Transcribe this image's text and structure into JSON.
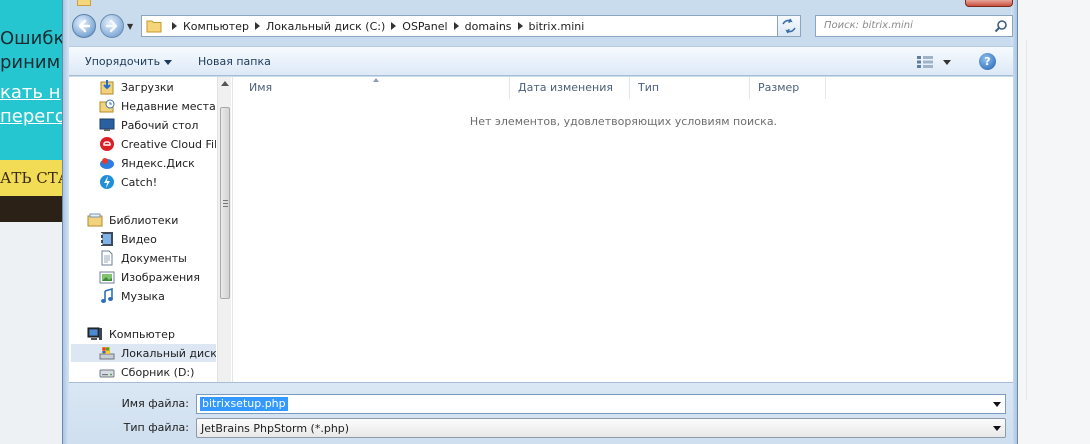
{
  "background": {
    "left_texts": [
      "Ошибк",
      "риним",
      "кать н",
      "перего"
    ],
    "yellow_text": "АТЬ СТА"
  },
  "address": {
    "crumbs": [
      "Компьютер",
      "Локальный диск (C:)",
      "OSPanel",
      "domains",
      "bitrix.mini"
    ],
    "search_placeholder": "Поиск: bitrix.mini"
  },
  "toolbar": {
    "organize_label": "Упорядочить",
    "new_folder_label": "Новая папка"
  },
  "nav": {
    "favorites": [
      {
        "label": "Загрузки",
        "icon": "downloads-icon"
      },
      {
        "label": "Недавние места",
        "icon": "recent-places-icon"
      },
      {
        "label": "Рабочий стол",
        "icon": "desktop-icon"
      },
      {
        "label": "Creative Cloud File",
        "icon": "creative-cloud-icon"
      },
      {
        "label": "Яндекс.Диск",
        "icon": "yandex-disk-icon"
      },
      {
        "label": "Catch!",
        "icon": "catch-icon"
      }
    ],
    "libraries_label": "Библиотеки",
    "libraries": [
      {
        "label": "Видео",
        "icon": "video-icon"
      },
      {
        "label": "Документы",
        "icon": "documents-icon"
      },
      {
        "label": "Изображения",
        "icon": "pictures-icon"
      },
      {
        "label": "Музыка",
        "icon": "music-icon"
      }
    ],
    "computer_label": "Компьютер",
    "drives": [
      {
        "label": "Локальный диск (",
        "icon": "local-disk-icon",
        "selected": true
      },
      {
        "label": "Сборник (D:)",
        "icon": "drive-icon",
        "selected": false
      }
    ]
  },
  "files": {
    "columns": [
      "Имя",
      "Дата изменения",
      "Тип",
      "Размер"
    ],
    "empty_message": "Нет элементов, удовлетворяющих условиям поиска."
  },
  "bottom": {
    "filename_label": "Имя файла:",
    "filename_value": "bitrixsetup.php",
    "filetype_label": "Тип файла:",
    "filetype_value": "JetBrains PhpStorm (*.php)"
  },
  "colors": {
    "accent": "#3399ff",
    "toolbar_text": "#1e3a5a",
    "frame": "#c9dcee"
  }
}
